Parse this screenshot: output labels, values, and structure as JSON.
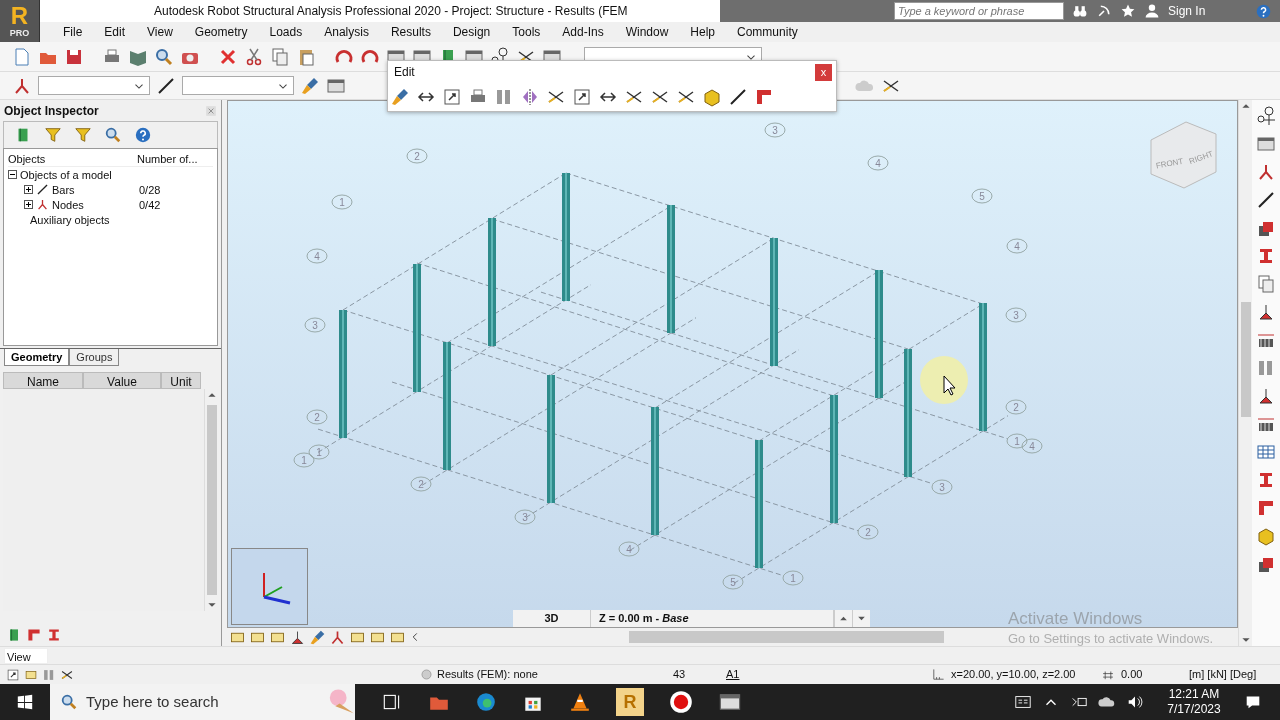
{
  "window": {
    "logo_letter": "R",
    "logo_badge": "PRO",
    "title": "Autodesk Robot Structural Analysis Professional 2020 - Project: Structure - Results (FEM"
  },
  "help_search": {
    "placeholder": "Type a keyword or phrase"
  },
  "sign_in": "Sign In",
  "menu": [
    "File",
    "Edit",
    "View",
    "Geometry",
    "Loads",
    "Analysis",
    "Results",
    "Design",
    "Tools",
    "Add-Ins",
    "Window",
    "Help",
    "Community"
  ],
  "edit_toolbar": {
    "title": "Edit",
    "close": "x"
  },
  "object_inspector": {
    "title": "Object Inspector",
    "columns": [
      "Objects",
      "Number of..."
    ],
    "tree": [
      {
        "label": "Objects of a model",
        "expanded": true,
        "children": [
          {
            "label": "Bars",
            "count": "0/28",
            "kind": "bar",
            "expanded": false
          },
          {
            "label": "Nodes",
            "count": "0/42",
            "kind": "node",
            "expanded": false
          }
        ]
      },
      {
        "label": "Auxiliary objects"
      }
    ],
    "tabs": [
      {
        "label": "Geometry",
        "selected": true
      },
      {
        "label": "Groups",
        "selected": false
      }
    ],
    "property_columns": [
      "Name",
      "Value",
      "Unit"
    ]
  },
  "viewport": {
    "view_cube": [
      "FRONT",
      "RIGHT"
    ],
    "grid_labels": [
      "2",
      "3",
      "4",
      "5",
      "1",
      "4",
      "4",
      "3",
      "3",
      "2",
      "2",
      "1",
      "1",
      "1",
      "4",
      "2",
      "3",
      "3",
      "2",
      "4",
      "5",
      "1"
    ],
    "view_bar": {
      "mode": "3D",
      "level": "Z = 0.00 m - *Base*"
    }
  },
  "activation": {
    "title": "Activate Windows",
    "subtitle": "Go to Settings to activate Windows."
  },
  "view_field": "View",
  "status_bar": {
    "results": "Results (FEM): none",
    "number": "43",
    "case": "A1",
    "coordinates": "x=20.00, y=10.00, z=2.00",
    "angle": "0.00",
    "units": "[m] [kN] [Deg]"
  },
  "taskbar": {
    "search_placeholder": "Type here to search",
    "app_letter": "R",
    "time": "12:21 AM",
    "date": "7/17/2023"
  }
}
